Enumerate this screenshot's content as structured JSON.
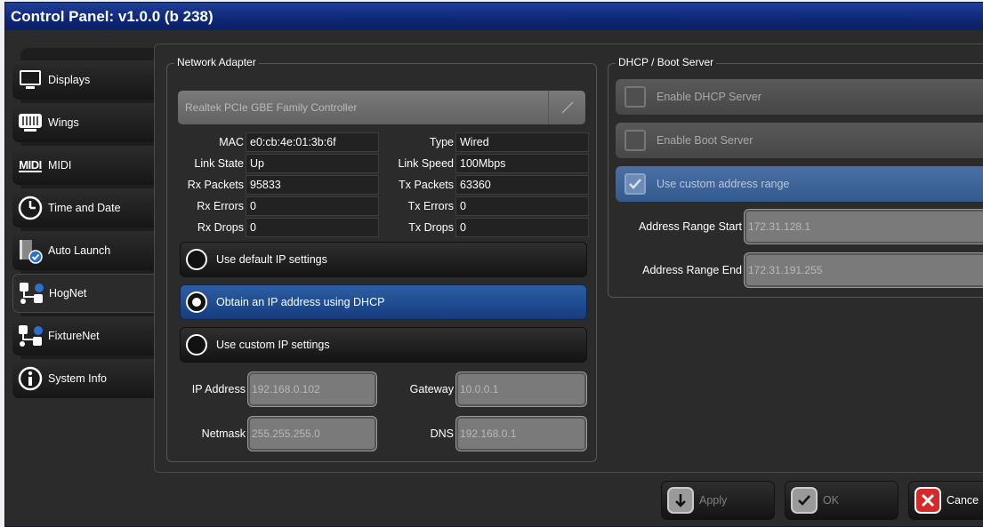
{
  "window": {
    "title": "Control Panel: v1.0.0 (b 238)"
  },
  "sidebar": {
    "items": [
      {
        "label": "Displays",
        "icon": "display-icon"
      },
      {
        "label": "Wings",
        "icon": "wings-icon"
      },
      {
        "label": "MIDI",
        "icon": "midi-icon"
      },
      {
        "label": "Time and Date",
        "icon": "clock-icon"
      },
      {
        "label": "Auto Launch",
        "icon": "auto-launch-icon"
      },
      {
        "label": "HogNet",
        "icon": "network-icon"
      },
      {
        "label": "FixtureNet",
        "icon": "network-icon"
      },
      {
        "label": "System Info",
        "icon": "info-icon"
      }
    ],
    "icon_labels": {
      "midi": "MIDI"
    }
  },
  "network_adapter": {
    "title": "Network Adapter",
    "adapter": "Realtek PCIe GBE Family Controller",
    "mac_label": "MAC",
    "mac": "e0:cb:4e:01:3b:6f",
    "type_label": "Type",
    "type": "Wired",
    "link_state_label": "Link State",
    "link_state": "Up",
    "link_speed_label": "Link Speed",
    "link_speed": "100Mbps",
    "rx_packets_label": "Rx Packets",
    "rx_packets": "95833",
    "tx_packets_label": "Tx Packets",
    "tx_packets": "63360",
    "rx_errors_label": "Rx Errors",
    "rx_errors": "0",
    "tx_errors_label": "Tx Errors",
    "tx_errors": "0",
    "rx_drops_label": "Rx Drops",
    "rx_drops": "0",
    "tx_drops_label": "Tx Drops",
    "tx_drops": "0",
    "options": {
      "default": "Use default IP settings",
      "dhcp": "Obtain an IP address using DHCP",
      "custom": "Use custom IP settings"
    },
    "ip_address_label": "IP Address",
    "ip_address": "192.168.0.102",
    "gateway_label": "Gateway",
    "gateway": "10.0.0.1",
    "netmask_label": "Netmask",
    "netmask": "255.255.255.0",
    "dns_label": "DNS",
    "dns": "192.168.0.1"
  },
  "dhcp_server": {
    "title": "DHCP / Boot Server",
    "enable_dhcp": "Enable DHCP Server",
    "enable_boot": "Enable Boot Server",
    "custom_range": "Use custom address range",
    "range_start_label": "Address Range Start",
    "range_start": "172.31.128.1",
    "range_end_label": "Address Range End",
    "range_end": "172.31.191.255"
  },
  "buttons": {
    "apply": "Apply",
    "ok": "OK",
    "cancel": "Cance"
  },
  "colors": {
    "titlebar": "#0e2777",
    "selected": "#1f4f93",
    "cancel_icon": "#d42a2a"
  }
}
